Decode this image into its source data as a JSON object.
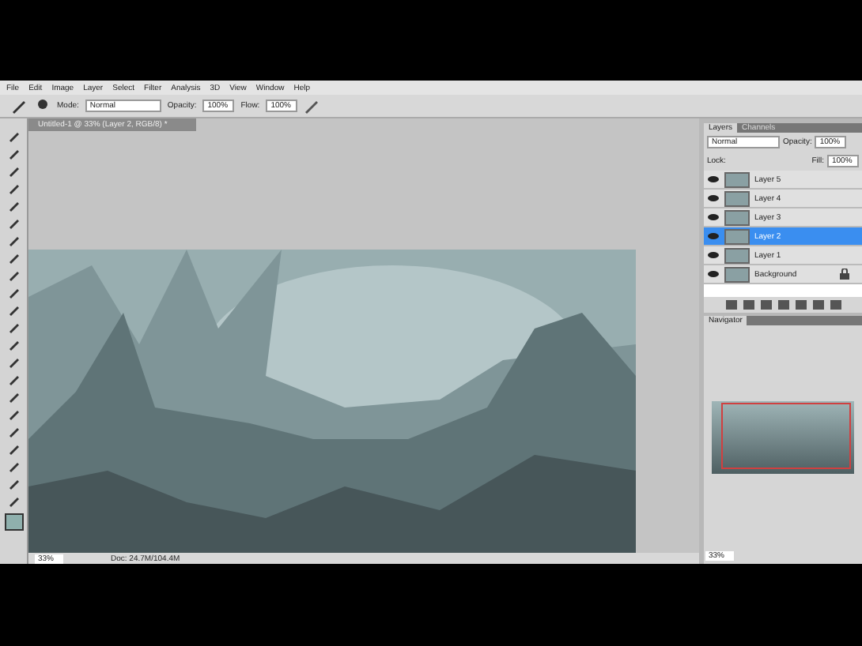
{
  "menu_bar": {
    "items": [
      "File",
      "Edit",
      "Image",
      "Layer",
      "Select",
      "Filter",
      "Analysis",
      "3D",
      "View",
      "Window",
      "Help"
    ]
  },
  "options_bar": {
    "mode_label": "Mode:",
    "mode": "Normal",
    "opacity_label": "Opacity:",
    "opacity": "100%",
    "flow_label": "Flow:",
    "flow": "100%"
  },
  "document": {
    "tab_title": "Untitled-1 @ 33% (Layer 2, RGB/8) *",
    "zoom": "33%",
    "doc_info": "Doc: 24.7M/104.4M"
  },
  "layers_panel": {
    "tabs": [
      {
        "label": "Layers",
        "selected": true
      },
      {
        "label": "Channels",
        "selected": false
      }
    ],
    "blend_mode": "Normal",
    "opacity_label": "Opacity:",
    "opacity": "100%",
    "lock_label": "Lock:",
    "fill_label": "Fill:",
    "fill": "100%",
    "layers": [
      {
        "name": "Layer 5",
        "selected": false,
        "visible": true,
        "locked": false
      },
      {
        "name": "Layer 4",
        "selected": false,
        "visible": true,
        "locked": false
      },
      {
        "name": "Layer 3",
        "selected": false,
        "visible": true,
        "locked": false
      },
      {
        "name": "Layer 2",
        "selected": true,
        "visible": true,
        "locked": false
      },
      {
        "name": "Layer 1",
        "selected": false,
        "visible": true,
        "locked": false
      },
      {
        "name": "Background",
        "selected": false,
        "visible": true,
        "locked": true
      }
    ]
  },
  "navigator_panel": {
    "tab": "Navigator",
    "zoom": "33%"
  }
}
